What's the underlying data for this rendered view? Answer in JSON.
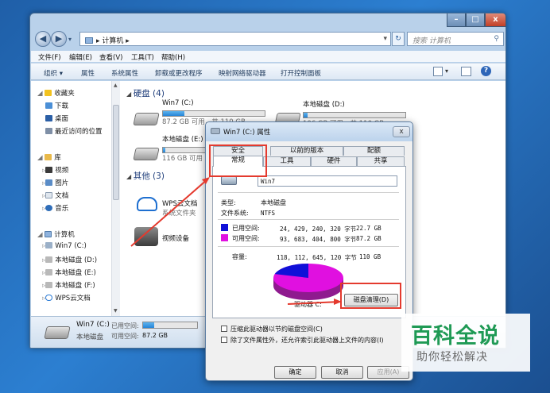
{
  "window": {
    "caption_buttons": {
      "minimize": "–",
      "maximize": "□",
      "close": "x"
    },
    "address": "▸ 计算机 ▸",
    "search_placeholder": "搜索 计算机"
  },
  "menu": [
    "文件(F)",
    "编辑(E)",
    "查看(V)",
    "工具(T)",
    "帮助(H)"
  ],
  "toolbar": [
    "组织 ▾",
    "属性",
    "系统属性",
    "卸载或更改程序",
    "映射网络驱动器",
    "打开控制面板"
  ],
  "sidebar": {
    "favorites": "收藏夹",
    "favorites_items": [
      "下载",
      "桌面",
      "最近访问的位置"
    ],
    "libraries": "库",
    "library_items": [
      "视频",
      "图片",
      "文档",
      "音乐"
    ],
    "computer": "计算机",
    "computer_items": [
      "Win7 (C:)",
      "本地磁盘 (D:)",
      "本地磁盘 (E:)",
      "本地磁盘 (F:)",
      "WPS云文档"
    ]
  },
  "main": {
    "hdd_section": "硬盘 (4)",
    "other_section": "其他 (3)",
    "drives": [
      {
        "name": "Win7 (C:)",
        "info": "87.2 GB 可用，共 110 GB",
        "used_fraction": 0.21
      },
      {
        "name": "本地磁盘 (D:)",
        "info": "106 GB 可用，共 110 GB",
        "used_fraction": 0.04
      },
      {
        "name": "本地磁盘 (E:)",
        "info": "116 GB 可用",
        "used_fraction": 0.06
      }
    ],
    "others": [
      {
        "name": "WPS云文档",
        "sub": "系统文件夹"
      },
      {
        "name": "视频设备",
        "sub": ""
      }
    ]
  },
  "details": {
    "name": "Win7 (C:)",
    "type": "本地磁盘",
    "used_label": "已用空间:",
    "free_label": "可用空间:",
    "free_value": "87.2 GB",
    "used_fraction": 0.21
  },
  "dialog": {
    "title": "Win7 (C:) 属性",
    "tabs_back": [
      "安全",
      "以前的版本",
      "配额"
    ],
    "tabs_front": [
      "常规",
      "工具",
      "硬件",
      "共享"
    ],
    "drive_name": "Win7",
    "type_label": "类型:",
    "type_value": "本地磁盘",
    "fs_label": "文件系统:",
    "fs_value": "NTFS",
    "used_label": "已用空间:",
    "used_bytes": "24, 429, 240, 320 字节",
    "used_gb": "22.7 GB",
    "free_label": "可用空间:",
    "free_bytes": "93, 683, 404, 800 字节",
    "free_gb": "87.2 GB",
    "capacity_label": "容量:",
    "capacity_bytes": "118, 112, 645, 120 字节",
    "capacity_gb": "110 GB",
    "drive_letter": "驱动器 C:",
    "cleanup_button": "磁盘清理(D)",
    "compress_check": "压缩此驱动器以节约磁盘空间(C)",
    "index_check": "除了文件属性外，还允许索引此驱动器上文件的内容(I)",
    "ok": "确定",
    "cancel": "取消",
    "apply": "应用(A)",
    "used_fraction": 0.206,
    "colors": {
      "used": "#1010d8",
      "free": "#e010e0"
    }
  },
  "watermark": {
    "title": "百科全说",
    "subtitle": "助你轻松解决"
  }
}
